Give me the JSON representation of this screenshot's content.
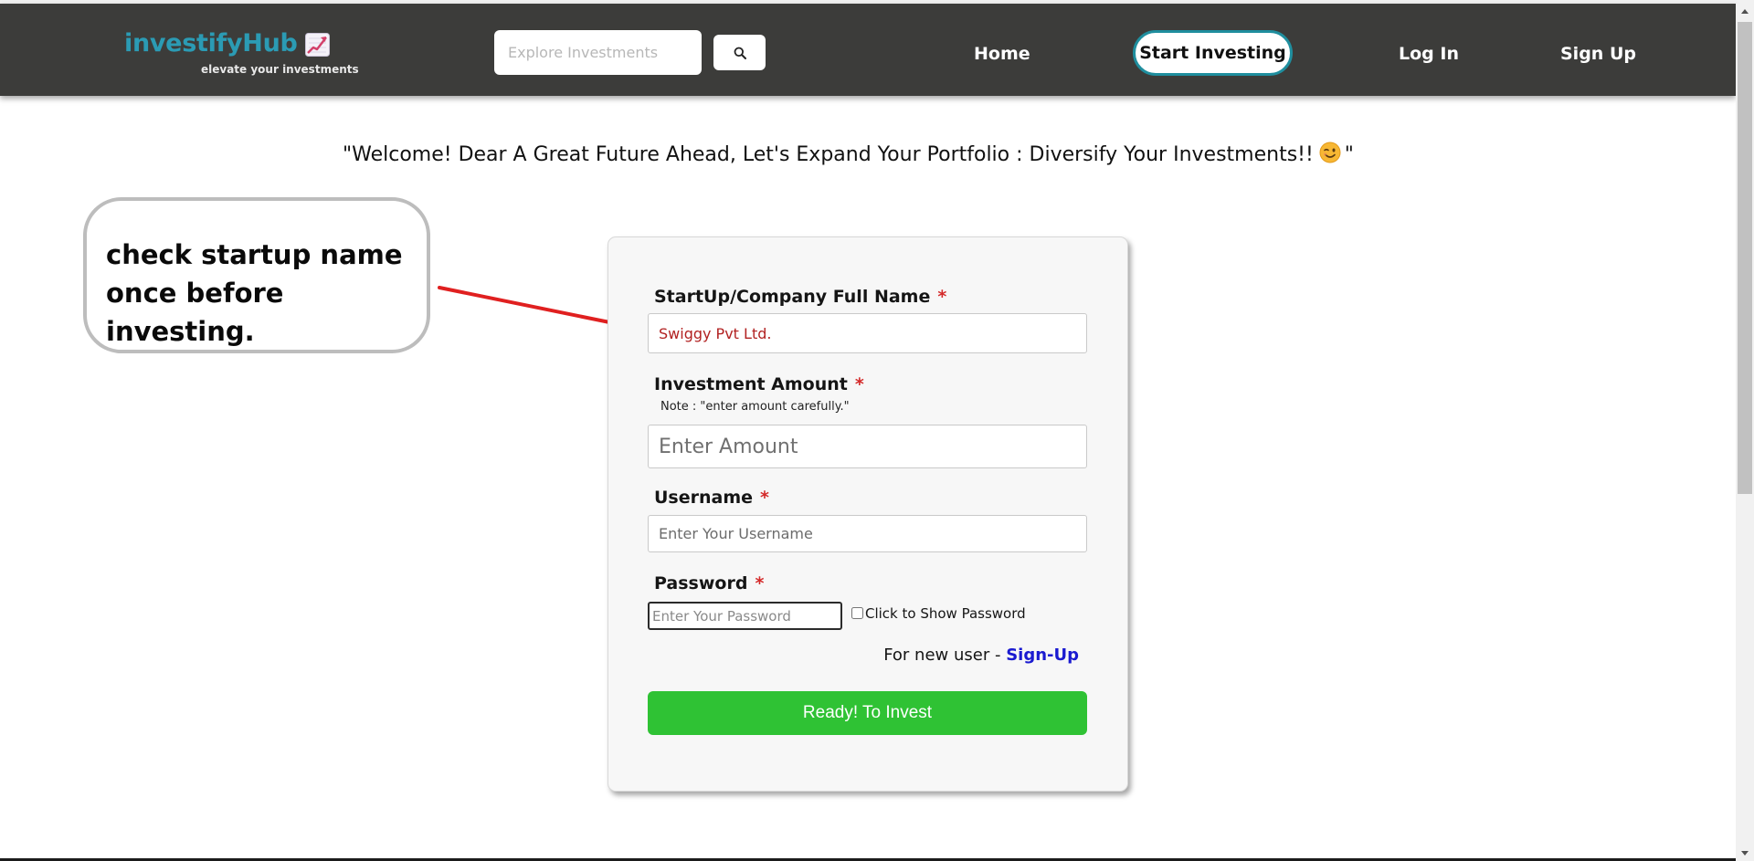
{
  "header": {
    "brand_name": "investifyHub",
    "brand_icon": "chart-increasing-icon",
    "tagline": "elevate your investments",
    "search_placeholder": "Explore Investments",
    "search_icon": "magnifier-icon",
    "nav": {
      "home": "Home",
      "start_investing": "Start Investing",
      "login": "Log In",
      "signup": "Sign Up"
    }
  },
  "welcome": {
    "text": "\"Welcome! Dear A Great Future Ahead, Let's Expand Your Portfolio : Diversify Your Investments!!",
    "closing_quote": "\"",
    "emoji": "winking-face-icon"
  },
  "callout": {
    "text": "check startup name once before investing."
  },
  "form": {
    "company_label": "StartUp/Company Full Name",
    "company_value": "Swiggy Pvt Ltd.",
    "amount_label": "Investment Amount",
    "amount_note": "Note : \"enter amount carefully.\"",
    "amount_placeholder": "Enter Amount",
    "username_label": "Username",
    "username_placeholder": "Enter Your Username",
    "password_label": "Password",
    "password_placeholder": "Enter Your Password",
    "show_password_label": "Click to Show Password",
    "new_user_text": "For new user -",
    "signup_link": "Sign-Up",
    "required_marker": "*",
    "submit_label": "Ready! To Invest"
  },
  "colors": {
    "navbar_bg": "#3c3c3a",
    "brand": "#2b9bb4",
    "button_border": "#1f8e9e",
    "submit_green": "#2fc234",
    "required_red": "#d42a2a",
    "company_value_red": "#b22222",
    "arrow_red": "#e02020",
    "link_blue": "#1a1ad0"
  }
}
